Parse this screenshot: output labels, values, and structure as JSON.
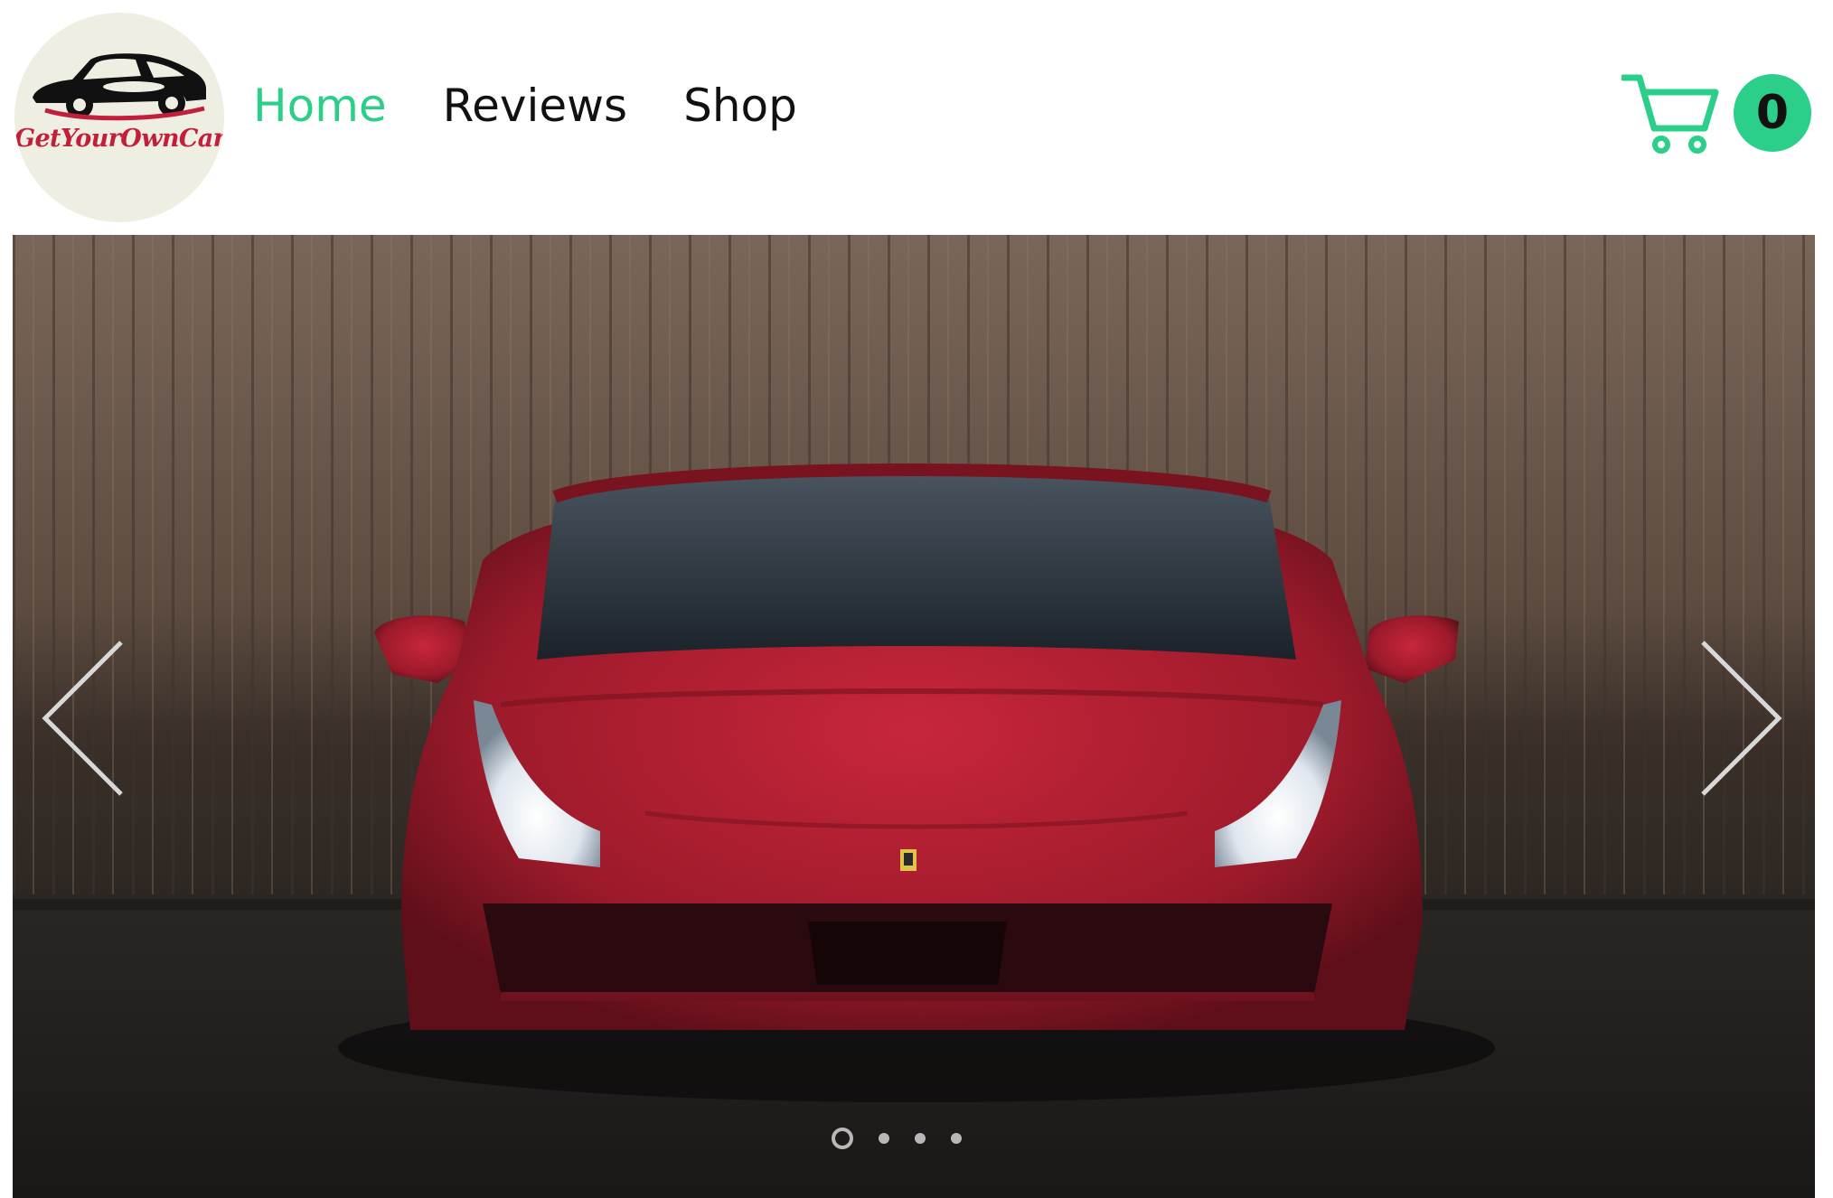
{
  "brand": {
    "logo_text": "GetYourOwnCar",
    "logo_icon": "classic-car-icon"
  },
  "nav": {
    "items": [
      {
        "label": "Home",
        "active": true
      },
      {
        "label": "Reviews",
        "active": false
      },
      {
        "label": "Shop",
        "active": false
      }
    ]
  },
  "cart": {
    "icon": "cart-icon",
    "count": "0"
  },
  "slideshow": {
    "image": "red-sports-car-front-view",
    "prev_icon": "chevron-left-icon",
    "next_icon": "chevron-right-icon",
    "total_slides": 4,
    "current_slide": 1
  },
  "colors": {
    "accent": "#2bcf8a",
    "text": "#111111",
    "logo_red": "#c2203a",
    "logo_bg": "#efeee2"
  }
}
